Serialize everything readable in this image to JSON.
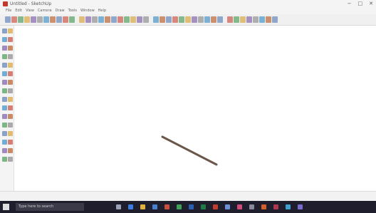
{
  "window": {
    "title": "Untitled - SketchUp"
  },
  "window_controls": {
    "minimize": "−",
    "maximize": "□",
    "close": "✕"
  },
  "menu": [
    "File",
    "Edit",
    "View",
    "Camera",
    "Draw",
    "Tools",
    "Window",
    "Help"
  ],
  "toolbar": {
    "icons": [
      "new-icon",
      "open-icon",
      "save-icon",
      "cut-icon",
      "copy-icon",
      "paste-icon",
      "erase-icon",
      "undo-icon",
      "redo-icon",
      "print-icon",
      "model-info-icon",
      "select-icon",
      "paint-icon",
      "push-pull-icon",
      "move-icon",
      "rotate-icon",
      "scale-icon",
      "offset-icon",
      "tape-icon",
      "text-icon",
      "axes-icon",
      "dimension-icon",
      "orbit-icon",
      "pan-icon",
      "zoom-icon",
      "zoom-window-icon",
      "zoom-extents-icon",
      "iso-view-icon",
      "top-view-icon",
      "front-view-icon",
      "right-view-icon",
      "back-view-icon",
      "left-view-icon",
      "xray-icon",
      "wireframe-icon",
      "hidden-line-icon",
      "shaded-icon",
      "textured-icon",
      "monochrome-icon",
      "warehouse-icon",
      "extension-icon"
    ],
    "measurements_value": ""
  },
  "left_tools": {
    "icons": [
      "select-icon",
      "component-icon",
      "paint-bucket-icon",
      "eraser-icon",
      "line-icon",
      "freehand-icon",
      "rectangle-icon",
      "rotated-rectangle-icon",
      "circle-icon",
      "polygon-icon",
      "arc-icon",
      "pie-icon",
      "move-icon",
      "push-pull-icon",
      "rotate-icon",
      "follow-me-icon",
      "scale-icon",
      "offset-icon",
      "tape-measure-icon",
      "dimension-icon",
      "protractor-icon",
      "text-icon",
      "axes-icon",
      "3d-text-icon",
      "orbit-icon",
      "pan-icon",
      "zoom-icon",
      "zoom-extents-icon",
      "position-camera-icon",
      "walk-icon",
      "look-around-icon",
      "section-plane-icon"
    ]
  },
  "canvas": {
    "object": "line-segment"
  },
  "statusbar": {
    "value": ""
  },
  "taskbar": {
    "search_placeholder": "Type here to search",
    "apps": [
      "task-view-icon",
      "edge-icon",
      "file-explorer-icon",
      "store-icon",
      "mail-icon",
      "chrome-icon",
      "word-icon",
      "excel-icon",
      "sketchup-icon",
      "photos-icon",
      "media-icon",
      "settings-icon",
      "app-icon",
      "app-icon-2",
      "app-icon-3",
      "app-icon-4"
    ],
    "tray": ""
  },
  "colors": {
    "line_stroke": "#6b574a",
    "taskbar": "#1e1e2c",
    "measurements_box": "#fbeebd"
  }
}
